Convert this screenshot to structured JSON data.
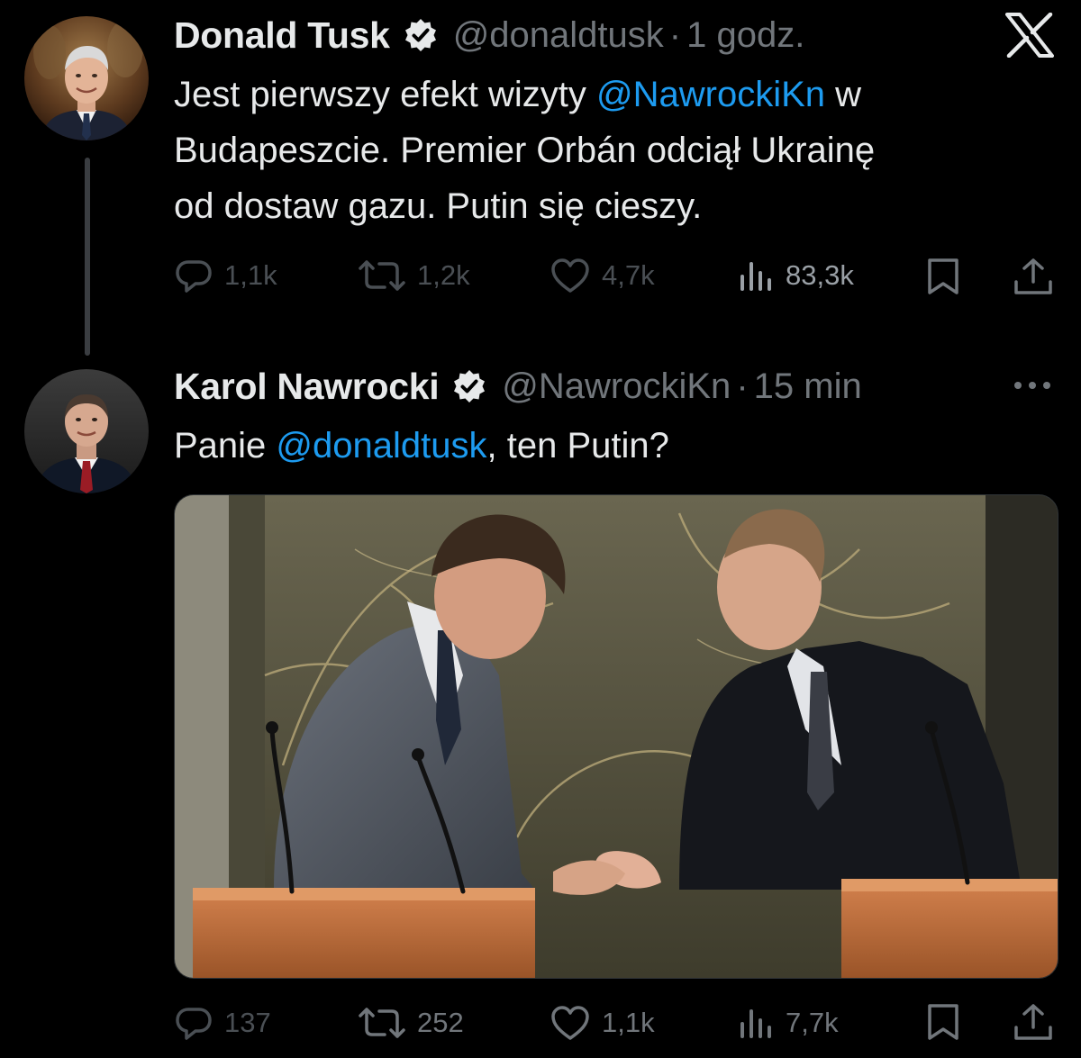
{
  "tweet1": {
    "author_name": "Donald Tusk",
    "handle": "@donaldtusk",
    "separator": "·",
    "time": "1 godz.",
    "text": {
      "line1_before": "Jest pierwszy efekt wizyty ",
      "line1_mention": "@NawrockiKn",
      "line1_after": " w",
      "line2": "Budapeszcie. Premier Orbán odciął Ukrainę",
      "line3": "od dostaw gazu. Putin się cieszy."
    },
    "stats": {
      "replies": "1,1k",
      "reposts": "1,2k",
      "likes": "4,7k",
      "views": "83,3k"
    }
  },
  "tweet2": {
    "author_name": "Karol Nawrocki",
    "handle": "@NawrockiKn",
    "separator": "·",
    "time": "15 min",
    "text": {
      "before": "Panie ",
      "mention": "@donaldtusk",
      "after": ", ten Putin?"
    },
    "stats": {
      "replies": "137",
      "reposts": "252",
      "likes": "1,1k",
      "views": "7,7k"
    }
  },
  "icons": {
    "app_logo": "x-logo-icon",
    "verified": "verified-badge-icon",
    "more": "more-options-icon",
    "reply": "reply-icon",
    "repost": "repost-icon",
    "like": "like-icon",
    "views": "views-icon",
    "bookmark": "bookmark-icon",
    "share": "share-icon"
  },
  "colors": {
    "background": "#000000",
    "text": "#e7e9ea",
    "muted": "#71767b",
    "link": "#1d9bf0",
    "verified_badge": "#e7e9ea"
  }
}
